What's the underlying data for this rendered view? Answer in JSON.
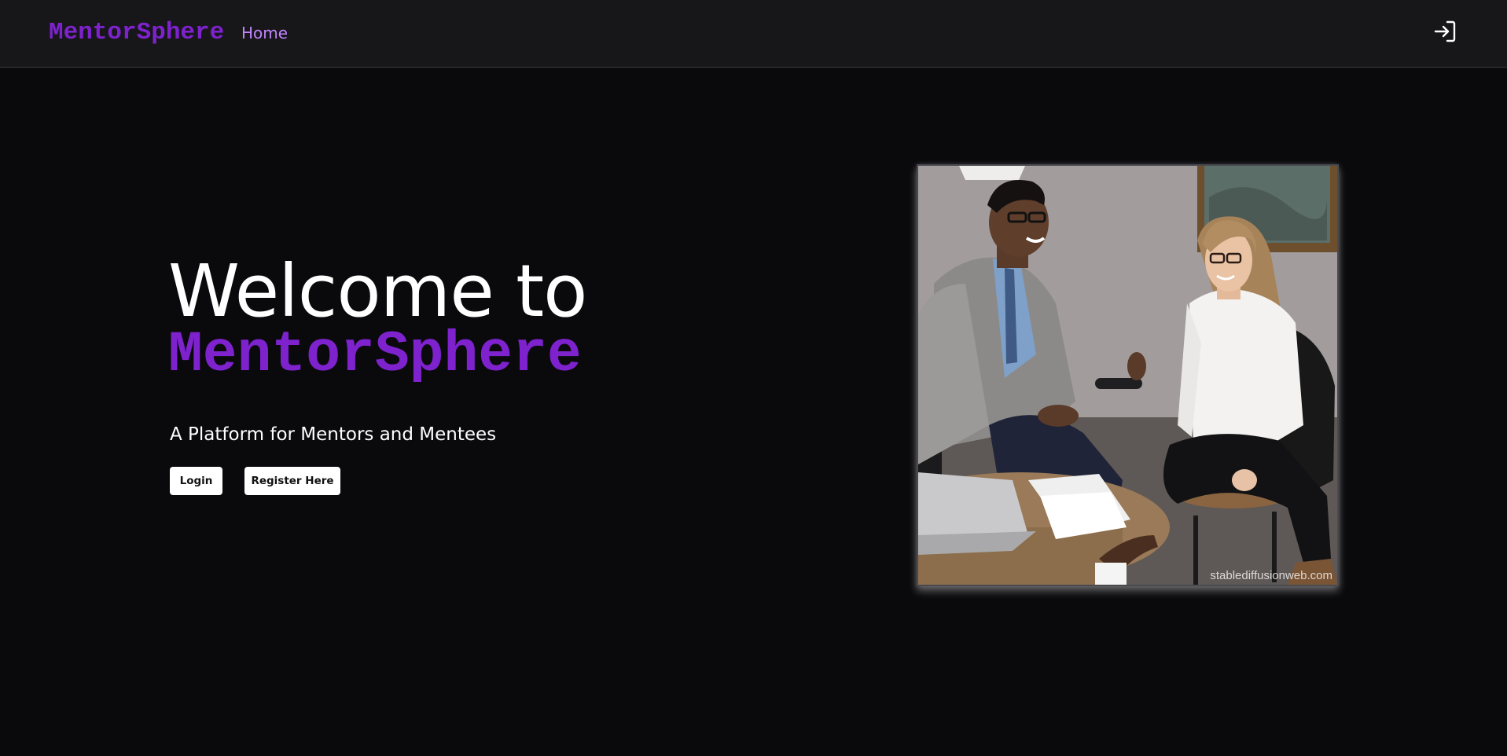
{
  "navbar": {
    "brand": "MentorSphere",
    "home_label": "Home",
    "login_icon": "login-arrow-icon"
  },
  "hero": {
    "title_line1": "Welcome to",
    "title_line2": "MentorSphere",
    "subtitle": "A Platform for Mentors and Mentees",
    "login_button": "Login",
    "register_button": "Register Here",
    "image_watermark": "stablediffusionweb.com"
  },
  "colors": {
    "background": "#0a0a0d",
    "navbar_background": "#17171a",
    "brand_purple": "#7e22ce",
    "home_link": "#c084fc",
    "text": "#ffffff",
    "button_background": "#ffffff",
    "button_text": "#111111"
  }
}
